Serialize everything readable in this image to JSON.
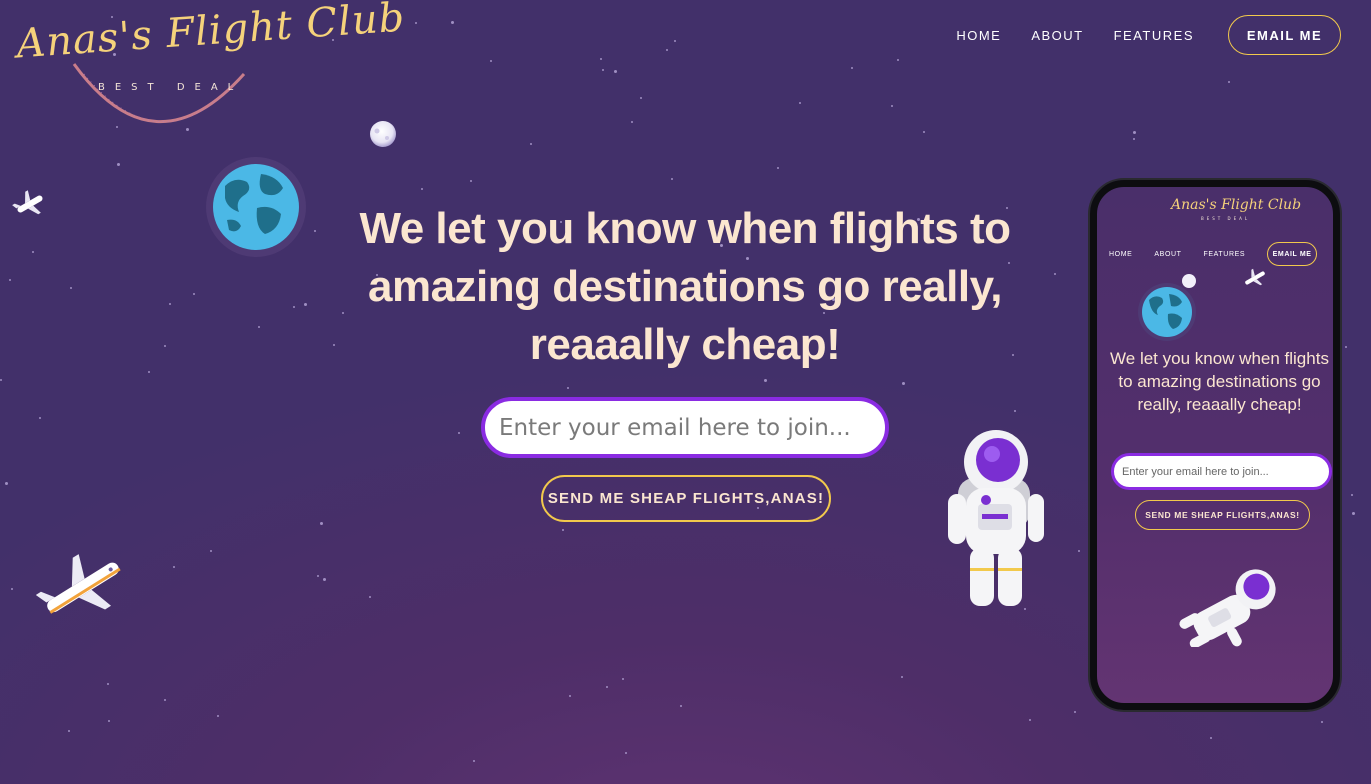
{
  "logo": {
    "title": "Anas's Flight Club",
    "subtitle": "BEST DEAL"
  },
  "nav": {
    "items": [
      {
        "label": "HOME"
      },
      {
        "label": "ABOUT"
      },
      {
        "label": "FEATURES"
      }
    ],
    "email_button": "EMAIL ME"
  },
  "hero": {
    "title": "We let you know when flights to amazing destinations go really, reaaally cheap!",
    "email_placeholder": "Enter your email here to join...",
    "send_button": "SEND ME SHEAP FLIGHTS,ANAS!"
  },
  "phone_preview": {
    "logo_title": "Anas's Flight Club",
    "logo_subtitle": "BEST DEAL",
    "nav_items": [
      "HOME",
      "ABOUT",
      "FEATURES"
    ],
    "email_button": "EMAIL ME",
    "title": "We let you know when flights to amazing destinations go really, reaaally cheap!",
    "email_placeholder": "Enter your email here to join...",
    "send_button": "SEND ME SHEAP FLIGHTS,ANAS!"
  },
  "colors": {
    "background": "#4e2e68",
    "accent_gold": "#f2c94c",
    "input_border": "#8a2be2",
    "heading_text": "#fbe6d0"
  },
  "icons": [
    "globe-icon",
    "moon-icon",
    "airplane-icon",
    "astronaut-icon"
  ]
}
